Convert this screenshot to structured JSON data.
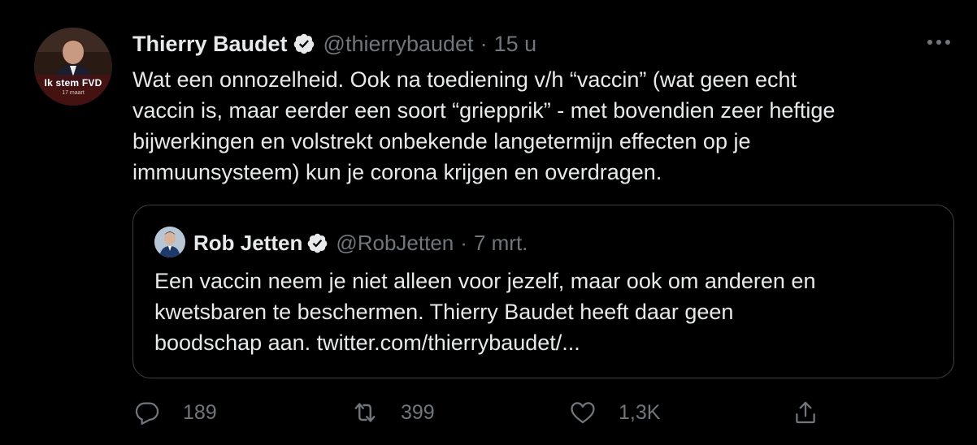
{
  "tweet": {
    "avatar": {
      "badge": "Ik stem FVD",
      "subtext": "17 maart"
    },
    "author": {
      "name": "Thierry Baudet",
      "handle": "@thierrybaudet",
      "separator": "·",
      "time": "15 u",
      "verified": true
    },
    "body_lines": [
      "Wat een onnozelheid. Ook na toediening v/h “vaccin” (wat geen echt",
      "vaccin is, maar eerder een soort “griepprik” - met bovendien zeer heftige",
      "bijwerkingen en volstrekt onbekende langetermijn effecten op je",
      "immuunsysteem) kun je corona krijgen en overdragen."
    ],
    "more_icon": "more-horizontal-icon"
  },
  "quoted": {
    "author": {
      "name": "Rob Jetten",
      "handle": "@RobJetten",
      "separator": "·",
      "time": "7 mrt.",
      "verified": true
    },
    "body_lines": [
      "Een vaccin neem je niet alleen voor jezelf, maar ook om anderen en",
      "kwetsbaren te beschermen. Thierry Baudet heeft daar geen",
      "boodschap aan. twitter.com/thierrybaudet/..."
    ]
  },
  "actions": {
    "reply": {
      "icon": "reply-icon",
      "count": "189"
    },
    "retweet": {
      "icon": "retweet-icon",
      "count": "399"
    },
    "like": {
      "icon": "heart-icon",
      "count": "1,3K"
    },
    "share": {
      "icon": "share-icon"
    }
  },
  "colors": {
    "background": "#000000",
    "text": "#e7e9ea",
    "secondary": "#71767b",
    "border": "#3e4144",
    "verified_badge": "#e7e9ea"
  }
}
